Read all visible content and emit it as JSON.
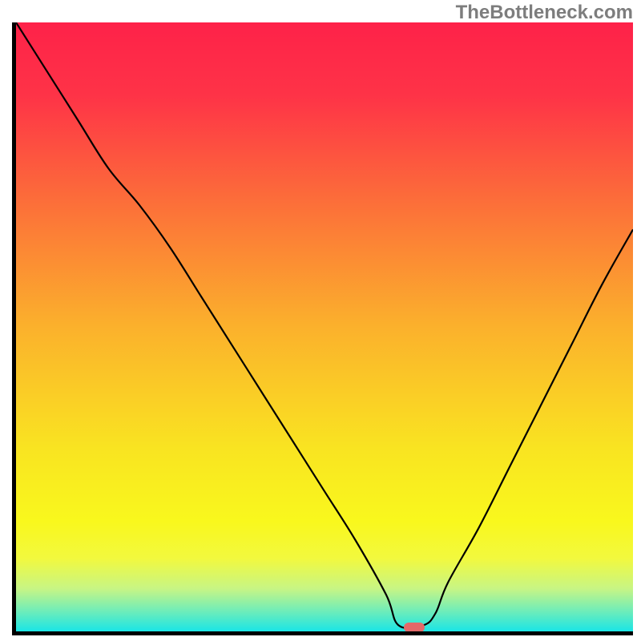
{
  "watermark": "TheBottleneck.com",
  "gradient": {
    "stops": [
      {
        "offset": 0.0,
        "color": "#fe2249"
      },
      {
        "offset": 0.12,
        "color": "#fe3347"
      },
      {
        "offset": 0.3,
        "color": "#fc7039"
      },
      {
        "offset": 0.5,
        "color": "#fbb12c"
      },
      {
        "offset": 0.7,
        "color": "#f9e421"
      },
      {
        "offset": 0.82,
        "color": "#f9f81d"
      },
      {
        "offset": 0.88,
        "color": "#f2f93e"
      },
      {
        "offset": 0.93,
        "color": "#c7f585"
      },
      {
        "offset": 0.965,
        "color": "#73edb7"
      },
      {
        "offset": 1.0,
        "color": "#1ae5e6"
      }
    ]
  },
  "minimum_marker": {
    "x_pct": 64.5,
    "y_pct": 99.3,
    "color": "#e46969"
  },
  "chart_data": {
    "type": "line",
    "title": "",
    "xlabel": "",
    "ylabel": "",
    "xlim": [
      0,
      100
    ],
    "ylim": [
      0,
      100
    ],
    "series": [
      {
        "name": "bottleneck-curve",
        "x": [
          0,
          5,
          10,
          15,
          20,
          25,
          30,
          35,
          40,
          45,
          50,
          55,
          60,
          62,
          66,
          68,
          70,
          75,
          80,
          85,
          90,
          95,
          100
        ],
        "values": [
          100,
          92,
          84,
          76,
          70,
          63,
          55,
          47,
          39,
          31,
          23,
          15,
          6,
          1,
          1,
          3,
          8,
          17,
          27,
          37,
          47,
          57,
          66
        ]
      }
    ],
    "annotations": [
      {
        "type": "minimum",
        "x": 64.5,
        "y": 0.7
      }
    ]
  }
}
